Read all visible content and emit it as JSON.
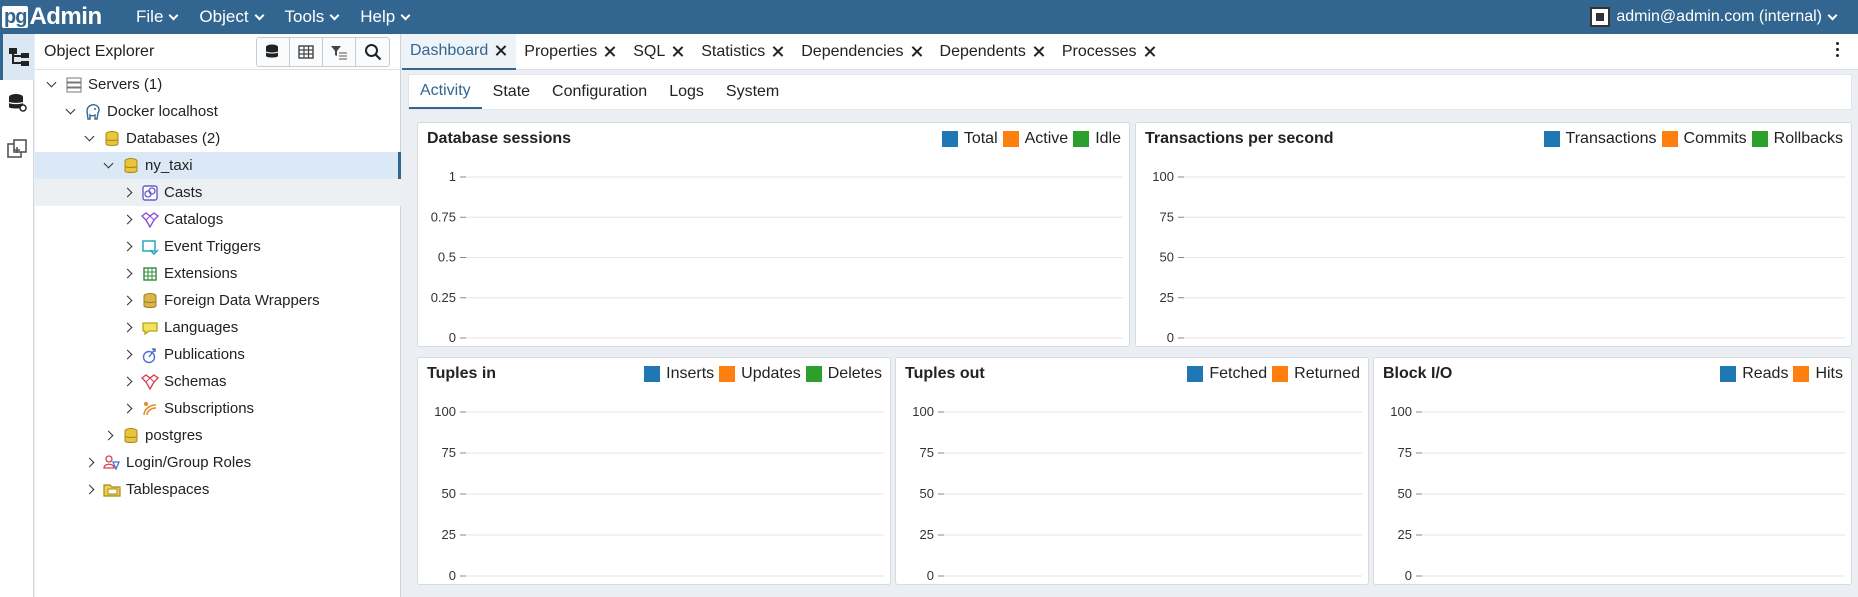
{
  "app": {
    "logo_pg": "pg",
    "logo_admin": "Admin"
  },
  "menu": [
    {
      "label": "File"
    },
    {
      "label": "Object"
    },
    {
      "label": "Tools"
    },
    {
      "label": "Help"
    }
  ],
  "user": {
    "label": "admin@admin.com (internal)"
  },
  "explorer": {
    "title": "Object Explorer",
    "tree": [
      {
        "label": "Servers",
        "count": "(1)"
      },
      {
        "label": "Docker localhost"
      },
      {
        "label": "Databases",
        "count": "(2)"
      },
      {
        "label": "ny_taxi"
      },
      {
        "label": "Casts"
      },
      {
        "label": "Catalogs"
      },
      {
        "label": "Event Triggers"
      },
      {
        "label": "Extensions"
      },
      {
        "label": "Foreign Data Wrappers"
      },
      {
        "label": "Languages"
      },
      {
        "label": "Publications"
      },
      {
        "label": "Schemas"
      },
      {
        "label": "Subscriptions"
      },
      {
        "label": "postgres"
      },
      {
        "label": "Login/Group Roles"
      },
      {
        "label": "Tablespaces"
      }
    ]
  },
  "tabs": [
    {
      "label": "Dashboard"
    },
    {
      "label": "Properties"
    },
    {
      "label": "SQL"
    },
    {
      "label": "Statistics"
    },
    {
      "label": "Dependencies"
    },
    {
      "label": "Dependents"
    },
    {
      "label": "Processes"
    }
  ],
  "subtabs": [
    {
      "label": "Activity"
    },
    {
      "label": "State"
    },
    {
      "label": "Configuration"
    },
    {
      "label": "Logs"
    },
    {
      "label": "System"
    }
  ],
  "colors": {
    "blue": "#1f77b4",
    "orange": "#ff7f0e",
    "green": "#2ca02c",
    "brand": "#326690"
  },
  "chart_data": [
    {
      "type": "line",
      "title": "Database sessions",
      "series": [
        {
          "name": "Total",
          "values": []
        },
        {
          "name": "Active",
          "values": []
        },
        {
          "name": "Idle",
          "values": []
        }
      ],
      "yticks": [
        "1",
        "0.75",
        "0.5",
        "0.25",
        "0"
      ],
      "ylim": [
        0,
        1
      ]
    },
    {
      "type": "line",
      "title": "Transactions per second",
      "series": [
        {
          "name": "Transactions",
          "values": []
        },
        {
          "name": "Commits",
          "values": []
        },
        {
          "name": "Rollbacks",
          "values": []
        }
      ],
      "yticks": [
        "100",
        "75",
        "50",
        "25",
        "0"
      ],
      "ylim": [
        0,
        100
      ]
    },
    {
      "type": "line",
      "title": "Tuples in",
      "series": [
        {
          "name": "Inserts",
          "values": []
        },
        {
          "name": "Updates",
          "values": []
        },
        {
          "name": "Deletes",
          "values": []
        }
      ],
      "yticks": [
        "100",
        "75",
        "50",
        "25",
        "0"
      ],
      "ylim": [
        0,
        100
      ]
    },
    {
      "type": "line",
      "title": "Tuples out",
      "series": [
        {
          "name": "Fetched",
          "values": []
        },
        {
          "name": "Returned",
          "values": []
        }
      ],
      "yticks": [
        "100",
        "75",
        "50",
        "25",
        "0"
      ],
      "ylim": [
        0,
        100
      ]
    },
    {
      "type": "line",
      "title": "Block I/O",
      "series": [
        {
          "name": "Reads",
          "values": []
        },
        {
          "name": "Hits",
          "values": []
        }
      ],
      "yticks": [
        "100",
        "75",
        "50",
        "25",
        "0"
      ],
      "ylim": [
        0,
        100
      ]
    }
  ]
}
